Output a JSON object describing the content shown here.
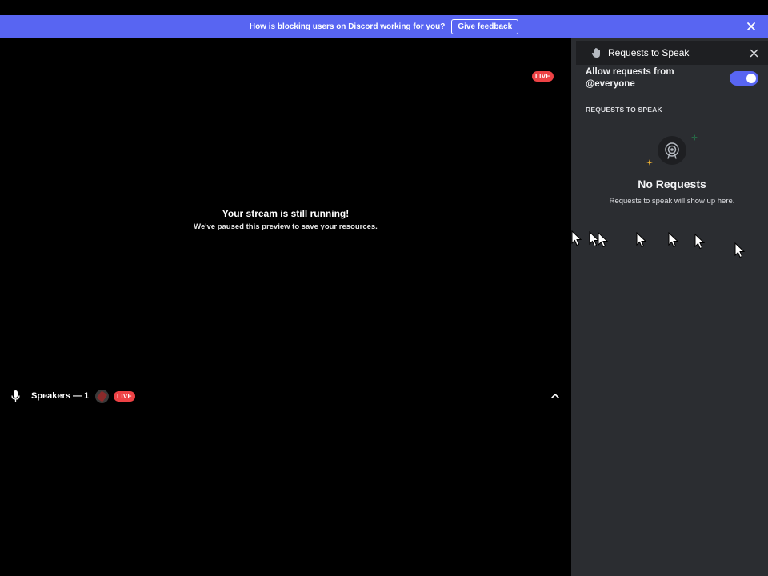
{
  "notice": {
    "message": "How is blocking users on Discord working for you?",
    "feedback_button": "Give feedback",
    "close_icon": "close-icon"
  },
  "stage": {
    "live_badge": "LIVE",
    "stream_title": "Your stream is still running!",
    "stream_subtitle": "We've paused this preview to save your resources.",
    "speakers_label": "Speakers — 1",
    "speaker_live_badge": "LIVE"
  },
  "panel": {
    "title": "Requests to Speak",
    "allow_label": "Allow requests from @everyone",
    "allow_toggle_on": true,
    "section_heading": "REQUESTS TO SPEAK",
    "empty_title": "No Requests",
    "empty_subtitle": "Requests to speak will show up here."
  },
  "colors": {
    "accent": "#5865f2",
    "live_red": "#ed4245",
    "panel_bg": "#2b2d31",
    "panel_header_bg": "#1e1f22"
  }
}
